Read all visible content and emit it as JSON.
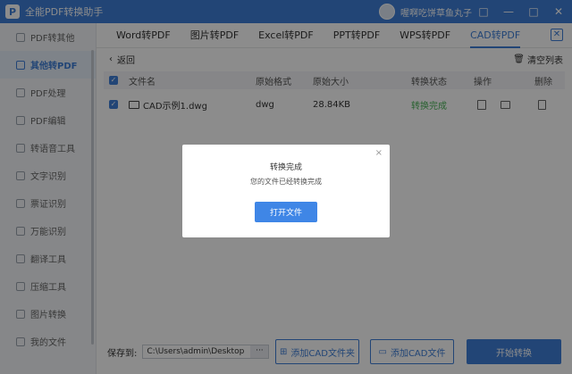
{
  "app": {
    "title": "全能PDF转换助手",
    "logo_letter": "P",
    "username": "喔啊吃饼草鱼丸子",
    "window_buttons": [
      "□",
      "—",
      "□",
      "✕"
    ]
  },
  "sidebar": {
    "items": [
      {
        "label": "PDF转其他",
        "active": false
      },
      {
        "label": "其他转PDF",
        "active": true
      },
      {
        "label": "PDF处理",
        "active": false
      },
      {
        "label": "PDF编辑",
        "active": false
      },
      {
        "label": "转语音工具",
        "active": false
      },
      {
        "label": "文字识别",
        "active": false
      },
      {
        "label": "票证识别",
        "active": false
      },
      {
        "label": "万能识别",
        "active": false
      },
      {
        "label": "翻译工具",
        "active": false
      },
      {
        "label": "压缩工具",
        "active": false
      },
      {
        "label": "图片转换",
        "active": false
      },
      {
        "label": "我的文件",
        "active": false
      }
    ]
  },
  "tabs": {
    "items": [
      "Word转PDF",
      "图片转PDF",
      "Excel转PDF",
      "PPT转PDF",
      "WPS转PDF",
      "CAD转PDF"
    ],
    "active_index": 5,
    "close_label": "✕"
  },
  "subbar": {
    "back_label": "返回",
    "clear_label": "清空列表"
  },
  "table": {
    "headers": {
      "file_name": "文件名",
      "original_format": "原始格式",
      "original_size": "原始大小",
      "status": "转换状态",
      "actions": "操作",
      "delete": "删除"
    },
    "rows": [
      {
        "file_name": "CAD示例1.dwg",
        "format": "dwg",
        "size": "28.84KB",
        "status": "转换完成"
      }
    ]
  },
  "bottom": {
    "save_label": "保存到:",
    "save_path": "C:\\Users\\admin\\Desktop",
    "path_more": "···",
    "add_folder_label": "添加CAD文件夹",
    "add_file_label": "添加CAD文件",
    "start_label": "开始转换"
  },
  "modal": {
    "title": "转换完成",
    "message": "您的文件已经转换完成",
    "close_label": "×",
    "open_button": "打开文件"
  },
  "colors": {
    "accent": "#3f7fd8",
    "success": "#4bb35a"
  }
}
